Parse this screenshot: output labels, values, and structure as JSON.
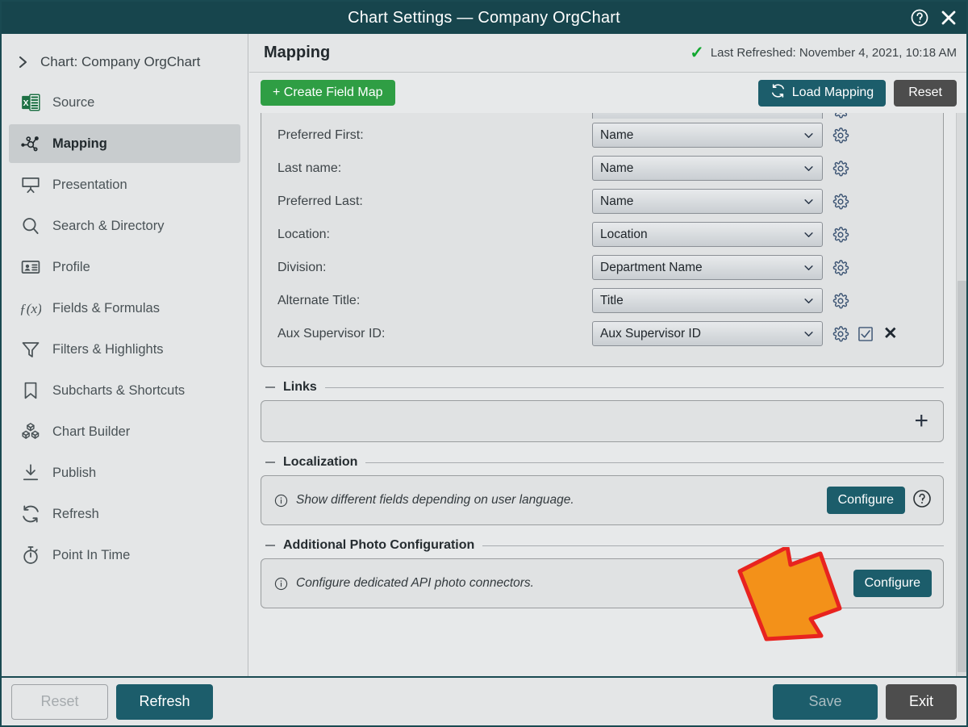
{
  "window": {
    "title": "Chart Settings — Company OrgChart",
    "help_icon": "help-circle-icon",
    "close_icon": "close-icon"
  },
  "sidebar": {
    "chart_header": {
      "label": "Chart: Company OrgChart",
      "icon": "chevron-right-icon"
    },
    "items": [
      {
        "label": "Source",
        "icon": "excel-icon",
        "active": false
      },
      {
        "label": "Mapping",
        "icon": "network-nodes-icon",
        "active": true
      },
      {
        "label": "Presentation",
        "icon": "projector-icon",
        "active": false
      },
      {
        "label": "Search & Directory",
        "icon": "search-icon",
        "active": false
      },
      {
        "label": "Profile",
        "icon": "id-card-icon",
        "active": false
      },
      {
        "label": "Fields & Formulas",
        "icon": "function-icon",
        "active": false
      },
      {
        "label": "Filters & Highlights",
        "icon": "funnel-icon",
        "active": false
      },
      {
        "label": "Subcharts & Shortcuts",
        "icon": "bookmark-icon",
        "active": false
      },
      {
        "label": "Chart Builder",
        "icon": "blocks-icon",
        "active": false
      },
      {
        "label": "Publish",
        "icon": "publish-icon",
        "active": false
      },
      {
        "label": "Refresh",
        "icon": "refresh-icon",
        "active": false
      },
      {
        "label": "Point In Time",
        "icon": "stopwatch-icon",
        "active": false
      }
    ]
  },
  "main": {
    "heading": "Mapping",
    "last_refreshed": "Last Refreshed: November 4, 2021, 10:18 AM",
    "status_icon": "green-check-icon",
    "toolbar": {
      "create_field_map": "+ Create Field Map",
      "load_mapping": "Load Mapping",
      "load_mapping_icon": "refresh-icon",
      "reset": "Reset"
    },
    "field_rows": [
      {
        "label": "",
        "value": "",
        "partial": true,
        "gear": true,
        "check": false,
        "remove": false
      },
      {
        "label": "Preferred First:",
        "value": "Name",
        "partial": false,
        "gear": true,
        "check": false,
        "remove": false
      },
      {
        "label": "Last name:",
        "value": "Name",
        "partial": false,
        "gear": true,
        "check": false,
        "remove": false
      },
      {
        "label": "Preferred Last:",
        "value": "Name",
        "partial": false,
        "gear": true,
        "check": false,
        "remove": false
      },
      {
        "label": "Location:",
        "value": "Location",
        "partial": false,
        "gear": true,
        "check": false,
        "remove": false
      },
      {
        "label": "Division:",
        "value": "Department Name",
        "partial": false,
        "gear": true,
        "check": false,
        "remove": false
      },
      {
        "label": "Alternate Title:",
        "value": "Title",
        "partial": false,
        "gear": true,
        "check": false,
        "remove": false
      },
      {
        "label": "Aux Supervisor ID:",
        "value": "Aux Supervisor ID",
        "partial": false,
        "gear": true,
        "check": true,
        "remove": true
      }
    ],
    "sections": {
      "links": {
        "legend": "Links",
        "add_icon": "plus-icon"
      },
      "localization": {
        "legend": "Localization",
        "info_icon": "info-circle-icon",
        "description": "Show different fields depending on user language.",
        "configure": "Configure",
        "help_icon": "help-circle-icon"
      },
      "photo": {
        "legend": "Additional Photo Configuration",
        "info_icon": "info-circle-icon",
        "description": "Configure dedicated API photo connectors.",
        "configure": "Configure"
      }
    },
    "scrollbar": {
      "name": "vertical-scrollbar"
    }
  },
  "footer": {
    "reset": "Reset",
    "refresh": "Refresh",
    "save": "Save",
    "exit": "Exit"
  },
  "annotation": {
    "type": "arrow",
    "points_to": "photo-configure-button",
    "fill": "#F39119",
    "stroke": "#E8231F"
  },
  "colors": {
    "titlebar": "#17454d",
    "accent_teal": "#1c5d6b",
    "accent_green": "#2f9e44",
    "panel": "#e7e9ea",
    "sidebar": "#e4e6e7",
    "active_item": "#c8ccce",
    "status_green": "#12a830"
  }
}
